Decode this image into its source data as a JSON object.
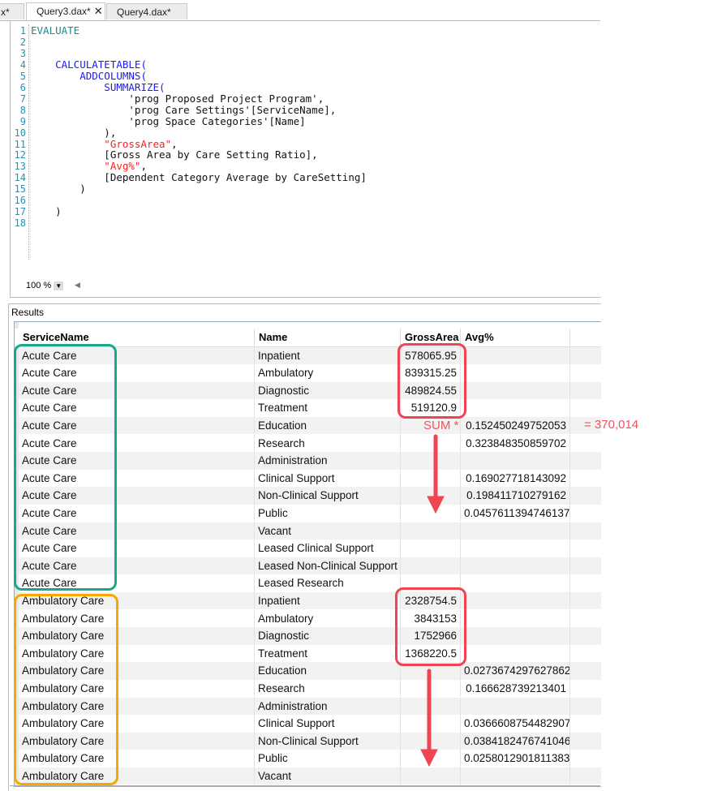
{
  "tabs": [
    {
      "label": "x*"
    },
    {
      "label": "Query3.dax*",
      "close": "✕"
    },
    {
      "label": "Query4.dax*"
    }
  ],
  "editor": {
    "lines": [
      [
        {
          "t": "EVALUATE",
          "c": "kw1"
        }
      ],
      [],
      [],
      [
        {
          "t": "    CALCULATETABLE(",
          "c": "kw"
        }
      ],
      [
        {
          "t": "        ADDCOLUMNS(",
          "c": "kw"
        }
      ],
      [
        {
          "t": "            SUMMARIZE(",
          "c": "kw"
        }
      ],
      [
        {
          "t": "                'prog Proposed Project Program',",
          "c": "txt"
        }
      ],
      [
        {
          "t": "                'prog Care Settings'[ServiceName],",
          "c": "txt"
        }
      ],
      [
        {
          "t": "                'prog Space Categories'[Name]",
          "c": "txt"
        }
      ],
      [
        {
          "t": "            ),",
          "c": "txt"
        }
      ],
      [
        {
          "t": "            \"GrossArea\"",
          "c": "str"
        },
        {
          "t": ",",
          "c": "txt"
        }
      ],
      [
        {
          "t": "            [Gross Area by Care Setting Ratio],",
          "c": "txt"
        }
      ],
      [
        {
          "t": "            \"Avg%\"",
          "c": "str"
        },
        {
          "t": ",",
          "c": "txt"
        }
      ],
      [
        {
          "t": "            [Dependent Category Average by CareSetting]",
          "c": "txt"
        }
      ],
      [
        {
          "t": "        )",
          "c": "txt"
        }
      ],
      [],
      [
        {
          "t": "    )",
          "c": "txt"
        }
      ],
      []
    ],
    "zoom": "100 %"
  },
  "results": {
    "label": "Results",
    "columns": [
      "ServiceName",
      "Name",
      "GrossArea",
      "Avg%"
    ],
    "rows": [
      [
        "Acute Care",
        "Inpatient",
        "578065.95",
        ""
      ],
      [
        "Acute Care",
        "Ambulatory",
        "839315.25",
        ""
      ],
      [
        "Acute Care",
        "Diagnostic",
        "489824.55",
        ""
      ],
      [
        "Acute Care",
        "Treatment",
        "519120.9",
        ""
      ],
      [
        "Acute Care",
        "Education",
        "",
        "0.152450249752053"
      ],
      [
        "Acute Care",
        "Research",
        "",
        "0.323848350859702"
      ],
      [
        "Acute Care",
        "Administration",
        "",
        ""
      ],
      [
        "Acute Care",
        "Clinical Support",
        "",
        "0.169027718143092"
      ],
      [
        "Acute Care",
        "Non-Clinical Support",
        "",
        "0.198411710279162"
      ],
      [
        "Acute Care",
        "Public",
        "",
        "0.0457611394746137"
      ],
      [
        "Acute Care",
        "Vacant",
        "",
        ""
      ],
      [
        "Acute Care",
        "Leased Clinical Support",
        "",
        ""
      ],
      [
        "Acute Care",
        "Leased Non-Clinical Support",
        "",
        ""
      ],
      [
        "Acute Care",
        "Leased Research",
        "",
        ""
      ],
      [
        "Ambulatory Care",
        "Inpatient",
        "2328754.5",
        ""
      ],
      [
        "Ambulatory Care",
        "Ambulatory",
        "3843153",
        ""
      ],
      [
        "Ambulatory Care",
        "Diagnostic",
        "1752966",
        ""
      ],
      [
        "Ambulatory Care",
        "Treatment",
        "1368220.5",
        ""
      ],
      [
        "Ambulatory Care",
        "Education",
        "",
        "0.0273674297627862"
      ],
      [
        "Ambulatory Care",
        "Research",
        "",
        "0.166628739213401"
      ],
      [
        "Ambulatory Care",
        "Administration",
        "",
        ""
      ],
      [
        "Ambulatory Care",
        "Clinical Support",
        "",
        "0.0366608754482907"
      ],
      [
        "Ambulatory Care",
        "Non-Clinical Support",
        "",
        "0.0384182476741046"
      ],
      [
        "Ambulatory Care",
        "Public",
        "",
        "0.0258012901811383"
      ],
      [
        "Ambulatory Care",
        "Vacant",
        "",
        ""
      ]
    ]
  },
  "annotations": {
    "sum_label": "SUM *",
    "result": "=  370,014",
    "colors": {
      "green": "#1aa88a",
      "orange": "#f5a800",
      "red": "#f04452"
    }
  }
}
